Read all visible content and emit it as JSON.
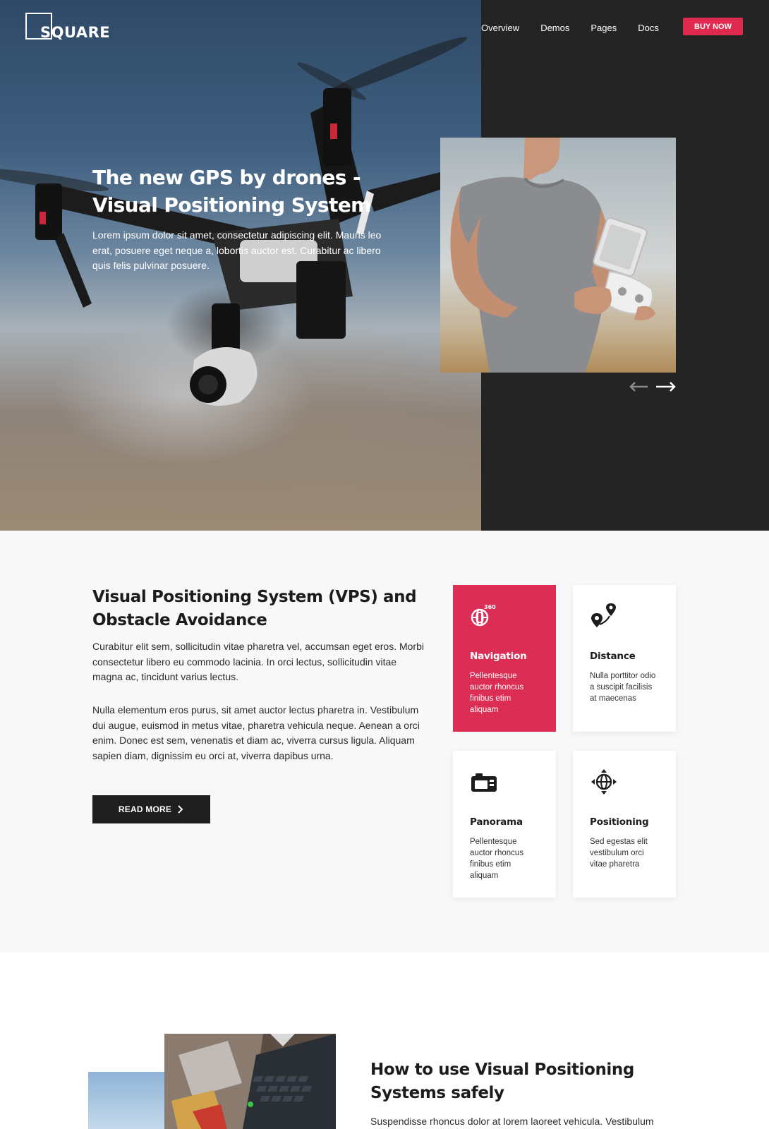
{
  "brand": {
    "logo_text": "SQUARE"
  },
  "nav": {
    "links": [
      "Overview",
      "Demos",
      "Pages",
      "Docs"
    ],
    "cta_label": "BUY NOW"
  },
  "hero": {
    "title": "The new GPS by drones - Visual Positioning System",
    "subtitle": "Lorem ipsum dolor sit amet, consectetur adipiscing elit. Mauris leo erat, posuere eget neque a, lobortis auctor est. Curabitur ac libero quis felis pulvinar posuere."
  },
  "features": {
    "title_bold_1": "Visual Positioning System",
    "title_light_1": " (VPS) ",
    "title_bold_2": "and",
    "title_light_2": "Obstacle Avoidance",
    "paragraph_1": "Curabitur elit sem, sollicitudin vitae pharetra vel, accumsan eget eros. Morbi consectetur libero eu commodo lacinia. In orci lectus, sollicitudin vitae magna ac, tincidunt varius lectus.",
    "paragraph_2": "Nulla elementum eros purus, sit amet auctor lectus pharetra in. Vestibulum dui augue, euismod in metus vitae, pharetra vehicula neque. Aenean a orci enim. Donec est sem, venenatis et diam ac, viverra cursus ligula. Aliquam sapien diam, dignissim eu orci at, viverra dapibus urna.",
    "read_more_label": "READ MORE",
    "cards": [
      {
        "icon": "navigation-360-icon",
        "badge": "360",
        "title": "Navigation",
        "description": "Pellentesque auctor rhoncus finibus etim aliquam",
        "active": true
      },
      {
        "icon": "distance-pins-icon",
        "title": "Distance",
        "description": "Nulla porttitor odio a suscipit facilisis at maecenas",
        "active": false
      },
      {
        "icon": "camera-icon",
        "title": "Panorama",
        "description": "Pellentesque auctor rhoncus finibus etim aliquam",
        "active": false
      },
      {
        "icon": "globe-arrows-icon",
        "title": "Positioning",
        "description": "Sed egestas elit vestibulum orci vitae pharetra",
        "active": false
      }
    ]
  },
  "howto": {
    "title": "How to use Visual Positioning Systems safely",
    "paragraph": "Suspendisse rhoncus dolor at lorem laoreet vehicula. Vestibulum"
  },
  "colors": {
    "accent": "#e0294f",
    "card_active": "#dc2d55",
    "dark_panel": "#242424",
    "section_bg": "#f8f8f9"
  }
}
